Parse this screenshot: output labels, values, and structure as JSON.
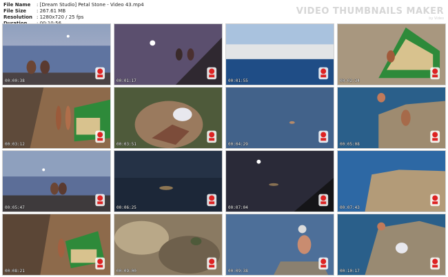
{
  "header": {
    "file_name_label": "File Name",
    "file_name": ": [Dream Studio] Petal Stone - Video 43.mp4",
    "file_size_label": "File Size",
    "file_size": ": 267.61 MB",
    "resolution_label": "Resolution",
    "resolution": ": 1280x720 / 25 fps",
    "duration_label": "Duration",
    "duration": ": 00:10:56"
  },
  "watermark": {
    "title": "VIDEO THUMBNAILS MAKER",
    "sub": "by Video"
  },
  "thumbnails": [
    {
      "time": "00:00:38",
      "scene": "two people seated on rocks at dusk by sea"
    },
    {
      "time": "00:01:17",
      "scene": "moon over sea, people on cliff"
    },
    {
      "time": "00:01:55",
      "scene": "fog bank over sea"
    },
    {
      "time": "00:02:34",
      "scene": "green tent on rocks"
    },
    {
      "time": "00:03:12",
      "scene": "person by green tent on rocks"
    },
    {
      "time": "00:03:51",
      "scene": "person climbing rocks"
    },
    {
      "time": "00:04:29",
      "scene": "swimmer in sea"
    },
    {
      "time": "00:05:08",
      "scene": "person on rocky outcrop"
    },
    {
      "time": "00:05:47",
      "scene": "two people seated at dusk"
    },
    {
      "time": "00:06:25",
      "scene": "moon reflection on dark sea"
    },
    {
      "time": "00:07:04",
      "scene": "moon over dark sea and cliff"
    },
    {
      "time": "00:07:43",
      "scene": "large rock in sea"
    },
    {
      "time": "00:08:21",
      "scene": "person by green tent"
    },
    {
      "time": "00:09:00",
      "scene": "rocky shore close-up"
    },
    {
      "time": "00:09:38",
      "scene": "person seated on rock by sea"
    },
    {
      "time": "00:10:17",
      "scene": "people on rocky outcrop"
    }
  ]
}
